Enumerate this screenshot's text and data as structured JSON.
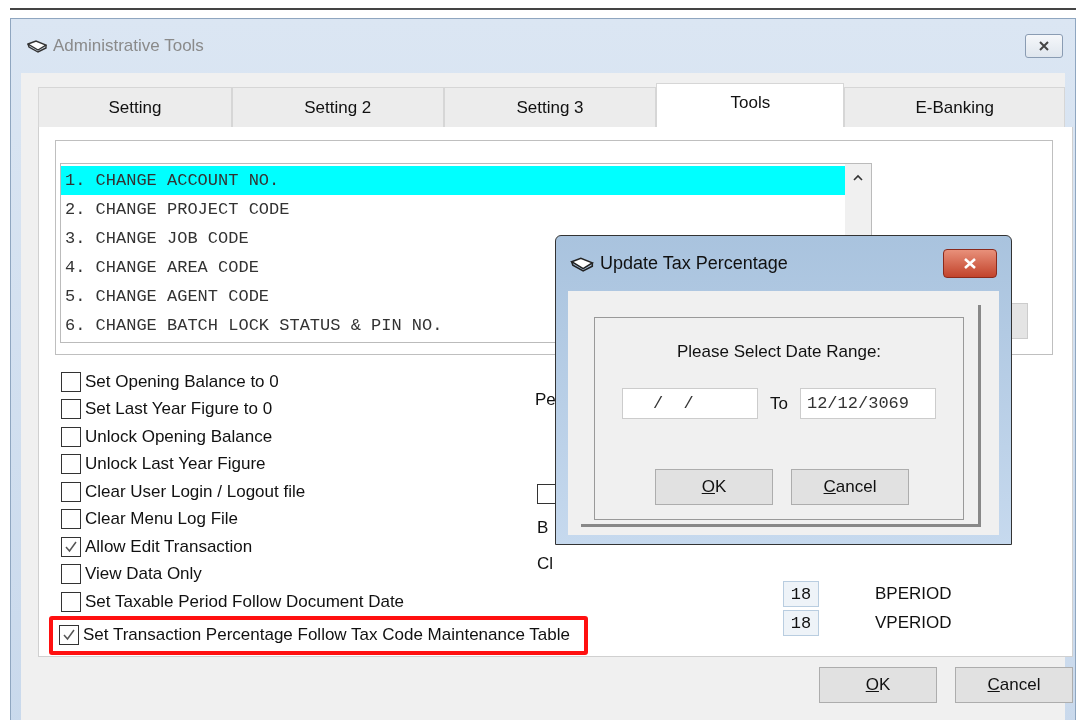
{
  "window": {
    "title": "Administrative Tools"
  },
  "tabs": [
    {
      "label": "Setting",
      "selected": false
    },
    {
      "label": "Setting 2",
      "selected": false
    },
    {
      "label": "Setting 3",
      "selected": false
    },
    {
      "label": "Tools",
      "selected": true
    },
    {
      "label": "E-Banking",
      "selected": false
    }
  ],
  "tools_list": [
    {
      "label": "1. CHANGE ACCOUNT NO.",
      "selected": true
    },
    {
      "label": "2. CHANGE PROJECT CODE",
      "selected": false
    },
    {
      "label": "3. CHANGE JOB CODE",
      "selected": false
    },
    {
      "label": "4. CHANGE AREA CODE",
      "selected": false
    },
    {
      "label": "5. CHANGE AGENT CODE",
      "selected": false
    },
    {
      "label": "6. CHANGE BATCH LOCK STATUS & PIN NO.",
      "selected": false
    }
  ],
  "options": [
    {
      "label": "Set Opening Balance to 0",
      "checked": false,
      "highlighted": false
    },
    {
      "label": "Set Last Year Figure to 0",
      "checked": false,
      "highlighted": false
    },
    {
      "label": "Unlock Opening Balance",
      "checked": false,
      "highlighted": false
    },
    {
      "label": "Unlock Last Year Figure",
      "checked": false,
      "highlighted": false
    },
    {
      "label": "Clear User Login / Logout file",
      "checked": false,
      "highlighted": false
    },
    {
      "label": "Clear Menu Log File",
      "checked": false,
      "highlighted": false
    },
    {
      "label": "Allow Edit Transaction",
      "checked": true,
      "highlighted": false
    },
    {
      "label": "View Data Only",
      "checked": false,
      "highlighted": false
    },
    {
      "label": "Set Taxable Period Follow Document Date",
      "checked": false,
      "highlighted": false
    },
    {
      "label": "Set Transaction Percentage Follow Tax Code Maintenance Table",
      "checked": true,
      "highlighted": true
    }
  ],
  "side": {
    "label_1": "Pe",
    "checkbox": {
      "checked": false
    },
    "label_2": "B",
    "label_3": "Cl"
  },
  "periods": [
    {
      "value": "18",
      "label": "BPERIOD"
    },
    {
      "value": "18",
      "label": "VPERIOD"
    }
  ],
  "buttons": [
    "OK",
    "Cancel"
  ],
  "dialog": {
    "title": "Update Tax Percentage",
    "prompt": "Please Select Date Range:",
    "from": {
      "value": "/  /"
    },
    "to_label": "To",
    "to": {
      "value": "12/12/3069"
    },
    "buttons": [
      "OK",
      "Cancel"
    ]
  }
}
